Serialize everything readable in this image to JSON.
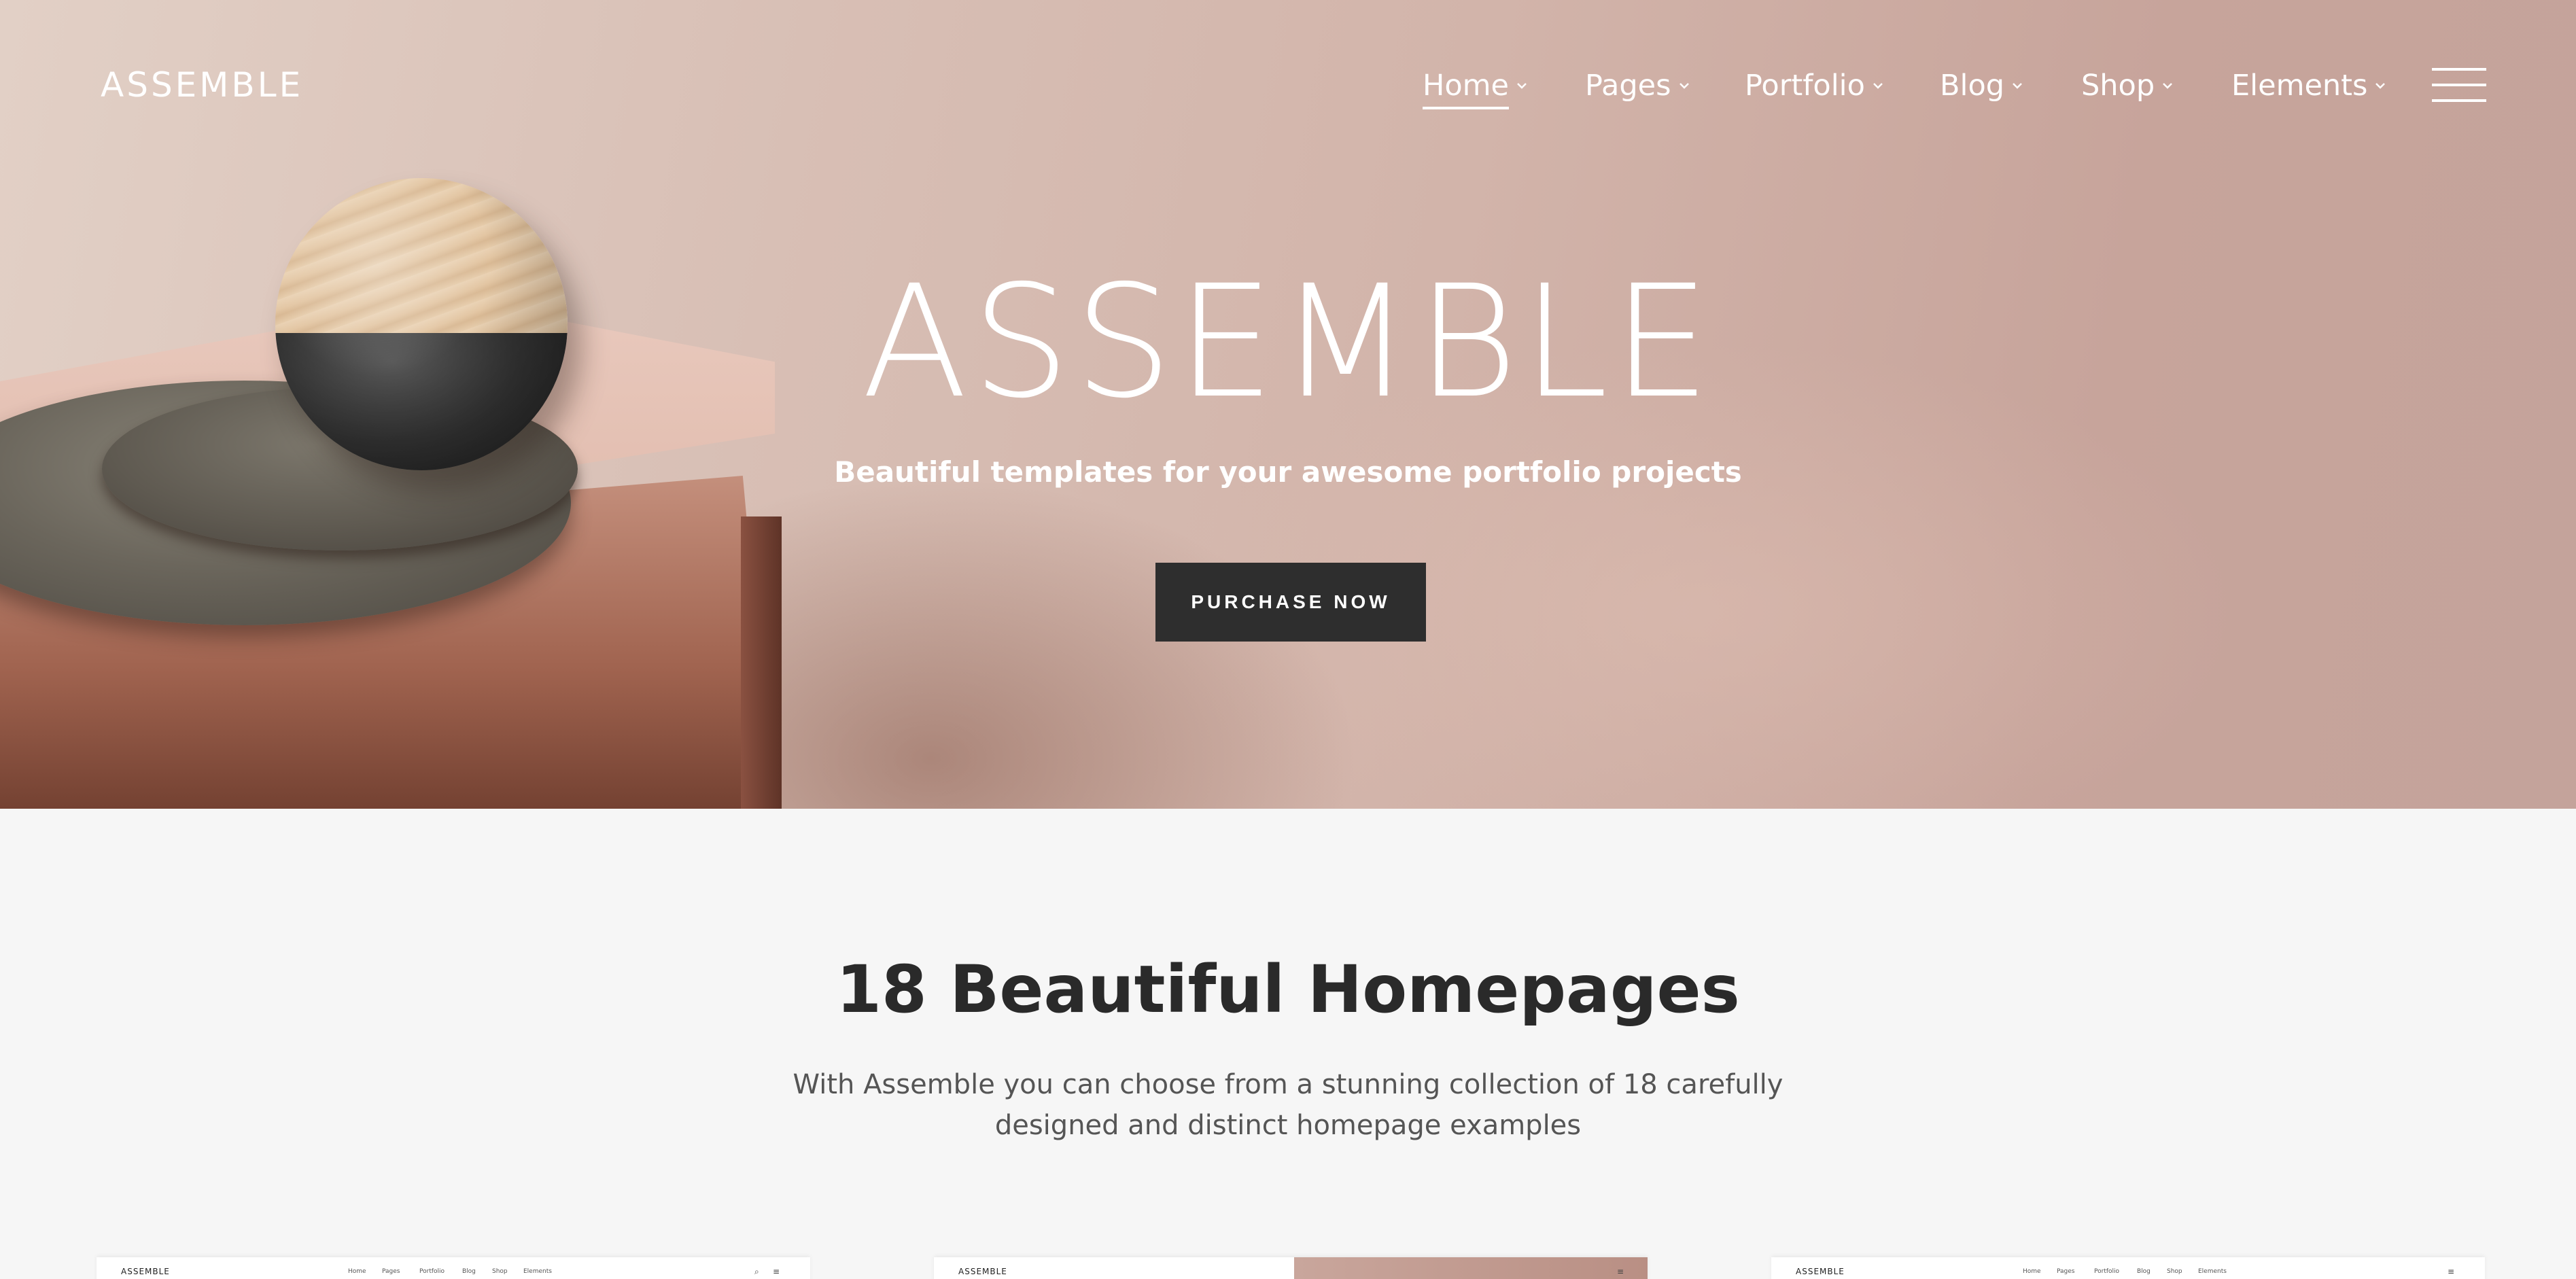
{
  "header": {
    "logo": "ASSEMBLE",
    "nav": [
      {
        "label": "Home",
        "active": true
      },
      {
        "label": "Pages",
        "active": false
      },
      {
        "label": "Portfolio",
        "active": false
      },
      {
        "label": "Blog",
        "active": false
      },
      {
        "label": "Shop",
        "active": false
      },
      {
        "label": "Elements",
        "active": false
      }
    ],
    "menu_icon": "hamburger-menu-icon"
  },
  "hero": {
    "title": "ASSEMBLE",
    "subtitle": "Beautiful templates for your awesome portfolio projects",
    "cta_label": "PURCHASE NOW"
  },
  "section": {
    "title": "18 Beautiful Homepages",
    "description": "With Assemble you can choose from a stunning collection of 18 carefully designed and distinct homepage examples"
  },
  "thumbnails": [
    {
      "logo": "ASSEMBLE",
      "nav": [
        "Home",
        "Pages",
        "Portfolio",
        "Blog",
        "Shop",
        "Elements"
      ]
    },
    {
      "logo": "ASSEMBLE"
    },
    {
      "logo": "ASSEMBLE",
      "nav": [
        "Home",
        "Pages",
        "Portfolio",
        "Blog",
        "Shop",
        "Elements"
      ]
    }
  ],
  "colors": {
    "hero_bg": "#d2b4aa",
    "cta_bg": "#2e2e2e",
    "page_bg": "#f6f6f6",
    "text_dark": "#2a2a2a"
  }
}
